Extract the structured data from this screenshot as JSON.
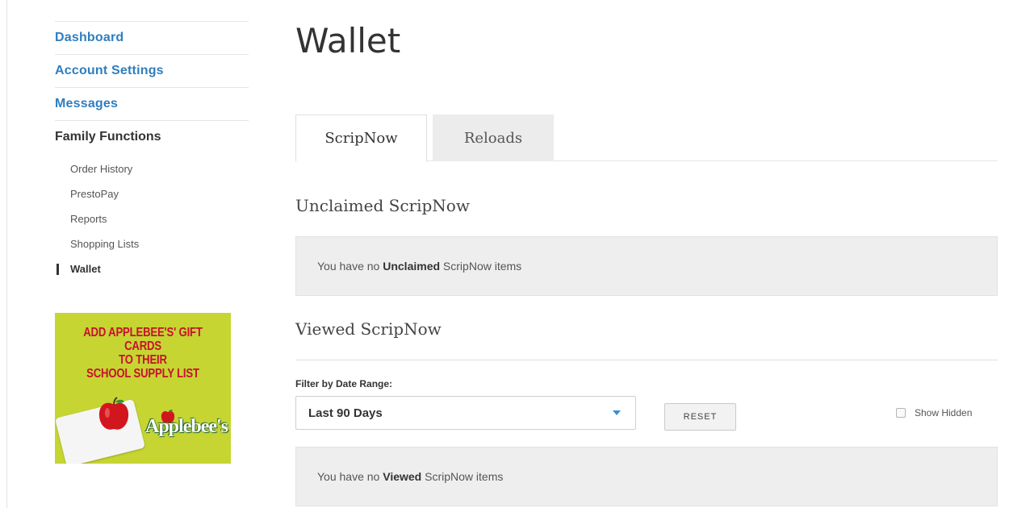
{
  "sidebar": {
    "nav": [
      {
        "label": "Dashboard"
      },
      {
        "label": "Account Settings"
      },
      {
        "label": "Messages"
      }
    ],
    "group_label": "Family Functions",
    "sub_items": [
      {
        "label": "Order History"
      },
      {
        "label": "PrestoPay"
      },
      {
        "label": "Reports"
      },
      {
        "label": "Shopping Lists"
      },
      {
        "label": "Wallet",
        "active": true
      }
    ],
    "promo": {
      "line1": "ADD APPLEBEE'S' GIFT CARDS",
      "line2": "TO THEIR",
      "line3": "SCHOOL SUPPLY LIST",
      "brand": "Applebee's"
    }
  },
  "main": {
    "title": "Wallet",
    "tabs": [
      {
        "label": "ScripNow",
        "active": true
      },
      {
        "label": "Reloads",
        "active": false
      }
    ],
    "unclaimed": {
      "heading": "Unclaimed ScripNow",
      "empty_prefix": "You have no ",
      "empty_bold": "Unclaimed",
      "empty_suffix": " ScripNow items"
    },
    "viewed": {
      "heading": "Viewed ScripNow",
      "filter_label": "Filter by Date Range:",
      "filter_value": "Last 90 Days",
      "reset_label": "RESET",
      "show_hidden_label": "Show Hidden",
      "empty_prefix": "You have no ",
      "empty_bold": "Viewed",
      "empty_suffix": " ScripNow items"
    }
  },
  "colors": {
    "link": "#2f7ebf",
    "promo_bg": "#c6d532",
    "promo_text": "#c8102e",
    "caret": "#3a8fd1"
  }
}
